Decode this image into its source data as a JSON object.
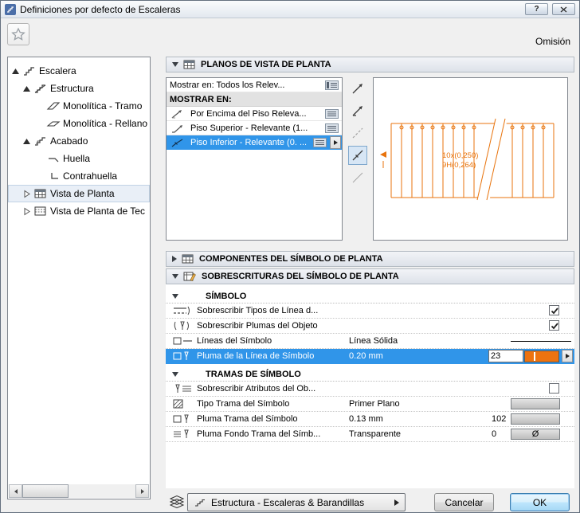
{
  "window": {
    "title": "Definiciones por defecto de Escaleras",
    "help_glyph": "?"
  },
  "toolbar": {
    "omission_label": "Omisión"
  },
  "tree": {
    "items": [
      {
        "label": "Escalera",
        "depth": 0,
        "state": "expanded",
        "icon": "stair-icon",
        "selected": false
      },
      {
        "label": "Estructura",
        "depth": 1,
        "state": "expanded",
        "icon": "structure-icon",
        "selected": false
      },
      {
        "label": "Monolítica - Tramo",
        "depth": 2,
        "state": "leaf",
        "icon": "flight-icon",
        "selected": false
      },
      {
        "label": "Monolítica - Rellano",
        "depth": 2,
        "state": "leaf",
        "icon": "landing-icon",
        "selected": false
      },
      {
        "label": "Acabado",
        "depth": 1,
        "state": "expanded",
        "icon": "finish-icon",
        "selected": false
      },
      {
        "label": "Huella",
        "depth": 2,
        "state": "leaf",
        "icon": "tread-icon",
        "selected": false
      },
      {
        "label": "Contrahuella",
        "depth": 2,
        "state": "leaf",
        "icon": "riser-icon",
        "selected": false
      },
      {
        "label": "Vista de Planta",
        "depth": 1,
        "state": "collapsed",
        "icon": "floor-plan-icon",
        "selected": true
      },
      {
        "label": "Vista de Planta de Tec",
        "depth": 1,
        "state": "collapsed",
        "icon": "ceiling-plan-icon",
        "selected": false
      }
    ]
  },
  "plan_views": {
    "title": "PLANOS DE VISTA DE PLANTA",
    "show_on_row_label": "Mostrar en: Todos los Relev...",
    "group_header": "MOSTRAR EN:",
    "rows": [
      {
        "label": "Por Encima del Piso Releva...",
        "selected": false
      },
      {
        "label": "Piso Superior - Relevante (1...",
        "selected": false
      },
      {
        "label": "Piso Inferior - Relevante (0. ...",
        "selected": true
      }
    ],
    "preview": {
      "label_line1": "10x(0,250)",
      "label_line2": "9H(0,264)",
      "color": "#e8730c"
    }
  },
  "components_section": {
    "title": "COMPONENTES DEL SÍMBOLO DE PLANTA"
  },
  "overrides_section": {
    "title": "SOBRESCRITURAS DEL SÍMBOLO DE PLANTA",
    "symbol_group": {
      "title": "SÍMBOLO",
      "rows": [
        {
          "label": "Sobrescribir Tipos de Línea d...",
          "checked": true
        },
        {
          "label": "Sobrescribir Plumas del Objeto",
          "checked": true
        },
        {
          "label": "Líneas del Símbolo",
          "value": "Línea Sólida"
        },
        {
          "label": "Pluma de la Línea de Símbolo",
          "value": "0.20 mm",
          "pen_number": "23",
          "pen_color": "#ed7310",
          "selected": true
        }
      ]
    },
    "fill_group": {
      "title": "TRAMAS DE SÍMBOLO",
      "rows": [
        {
          "label": "Sobrescribir Atributos del Ob...",
          "checked": false
        },
        {
          "label": "Tipo Trama del Símbolo",
          "value": "Primer Plano"
        },
        {
          "label": "Pluma Trama del Símbolo",
          "value": "0.13 mm",
          "pen_number": "102"
        },
        {
          "label": "Pluma Fondo Trama del Símb...",
          "value": "Transparente",
          "pen_number": "0",
          "swatch_glyph": "Ø"
        }
      ]
    }
  },
  "footer": {
    "layer_name": "Estructura - Escaleras & Barandillas",
    "cancel_label": "Cancelar",
    "ok_label": "OK"
  },
  "colors": {
    "selection_blue": "#3095e9",
    "accent_orange": "#e8730c",
    "pen_swatch_orange": "#ed7310"
  }
}
